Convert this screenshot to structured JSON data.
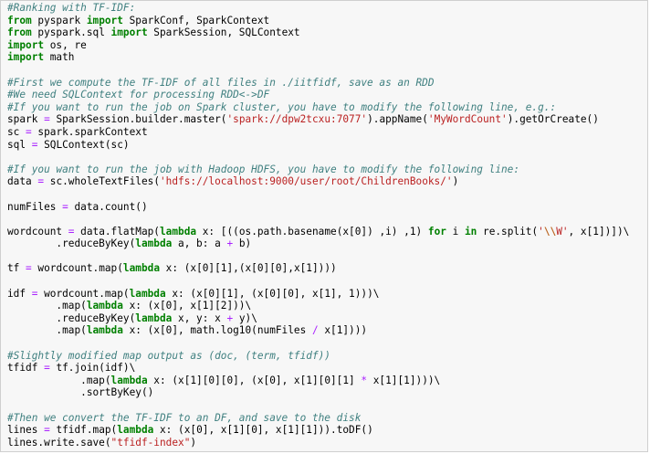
{
  "cell": {
    "lines": [
      [
        {
          "t": "c",
          "v": "#Ranking with TF-IDF:"
        }
      ],
      [
        {
          "t": "k",
          "v": "from"
        },
        {
          "t": "p",
          "v": " pyspark "
        },
        {
          "t": "k",
          "v": "import"
        },
        {
          "t": "p",
          "v": " SparkConf, SparkContext"
        }
      ],
      [
        {
          "t": "k",
          "v": "from"
        },
        {
          "t": "p",
          "v": " pyspark.sql "
        },
        {
          "t": "k",
          "v": "import"
        },
        {
          "t": "p",
          "v": " SparkSession, SQLContext"
        }
      ],
      [
        {
          "t": "k",
          "v": "import"
        },
        {
          "t": "p",
          "v": " os, re"
        }
      ],
      [
        {
          "t": "k",
          "v": "import"
        },
        {
          "t": "p",
          "v": " math"
        }
      ],
      [],
      [
        {
          "t": "c",
          "v": "#First we compute the TF-IDF of all files in ./iitfidf, save as an RDD"
        }
      ],
      [
        {
          "t": "c",
          "v": "#We need SQLContext for processing RDD<->DF"
        }
      ],
      [
        {
          "t": "c",
          "v": "#If you want to run the job on Spark cluster, you have to modify the following line, e.g.:"
        }
      ],
      [
        {
          "t": "p",
          "v": "spark "
        },
        {
          "t": "o",
          "v": "="
        },
        {
          "t": "p",
          "v": " SparkSession.builder.master("
        },
        {
          "t": "s",
          "v": "'spark://dpw2tcxu:7077'"
        },
        {
          "t": "p",
          "v": ").appName("
        },
        {
          "t": "s",
          "v": "'MyWordCount'"
        },
        {
          "t": "p",
          "v": ").getOrCreate()"
        }
      ],
      [
        {
          "t": "p",
          "v": "sc "
        },
        {
          "t": "o",
          "v": "="
        },
        {
          "t": "p",
          "v": " spark.sparkContext"
        }
      ],
      [
        {
          "t": "p",
          "v": "sql "
        },
        {
          "t": "o",
          "v": "="
        },
        {
          "t": "p",
          "v": " SQLContext(sc)"
        }
      ],
      [],
      [
        {
          "t": "c",
          "v": "#If you want to run the job with Hadoop HDFS, you have to modify the following line:"
        }
      ],
      [
        {
          "t": "p",
          "v": "data "
        },
        {
          "t": "o",
          "v": "="
        },
        {
          "t": "p",
          "v": " sc.wholeTextFiles("
        },
        {
          "t": "s",
          "v": "'hdfs://localhost:9000/user/root/ChildrenBooks/'"
        },
        {
          "t": "p",
          "v": ")"
        }
      ],
      [],
      [
        {
          "t": "p",
          "v": "numFiles "
        },
        {
          "t": "o",
          "v": "="
        },
        {
          "t": "p",
          "v": " data.count()"
        }
      ],
      [],
      [
        {
          "t": "p",
          "v": "wordcount "
        },
        {
          "t": "o",
          "v": "="
        },
        {
          "t": "p",
          "v": " data.flatMap("
        },
        {
          "t": "k",
          "v": "lambda"
        },
        {
          "t": "p",
          "v": " x: [((os.path.basename(x[0]) ,i) ,1) "
        },
        {
          "t": "k",
          "v": "for"
        },
        {
          "t": "p",
          "v": " i "
        },
        {
          "t": "k",
          "v": "in"
        },
        {
          "t": "p",
          "v": " re.split("
        },
        {
          "t": "s",
          "v": "'"
        },
        {
          "t": "se",
          "v": "\\\\"
        },
        {
          "t": "s",
          "v": "W'"
        },
        {
          "t": "p",
          "v": ", x[1])])\\"
        }
      ],
      [
        {
          "t": "p",
          "v": "        .reduceByKey("
        },
        {
          "t": "k",
          "v": "lambda"
        },
        {
          "t": "p",
          "v": " a, b: a "
        },
        {
          "t": "o",
          "v": "+"
        },
        {
          "t": "p",
          "v": " b)"
        }
      ],
      [],
      [
        {
          "t": "p",
          "v": "tf "
        },
        {
          "t": "o",
          "v": "="
        },
        {
          "t": "p",
          "v": " wordcount.map("
        },
        {
          "t": "k",
          "v": "lambda"
        },
        {
          "t": "p",
          "v": " x: (x[0][1],(x[0][0],x[1])))"
        }
      ],
      [],
      [
        {
          "t": "p",
          "v": "idf "
        },
        {
          "t": "o",
          "v": "="
        },
        {
          "t": "p",
          "v": " wordcount.map("
        },
        {
          "t": "k",
          "v": "lambda"
        },
        {
          "t": "p",
          "v": " x: (x[0][1], (x[0][0], x[1], 1)))\\"
        }
      ],
      [
        {
          "t": "p",
          "v": "        .map("
        },
        {
          "t": "k",
          "v": "lambda"
        },
        {
          "t": "p",
          "v": " x: (x[0], x[1][2]))\\"
        }
      ],
      [
        {
          "t": "p",
          "v": "        .reduceByKey("
        },
        {
          "t": "k",
          "v": "lambda"
        },
        {
          "t": "p",
          "v": " x, y: x "
        },
        {
          "t": "o",
          "v": "+"
        },
        {
          "t": "p",
          "v": " y)\\"
        }
      ],
      [
        {
          "t": "p",
          "v": "        .map("
        },
        {
          "t": "k",
          "v": "lambda"
        },
        {
          "t": "p",
          "v": " x: (x[0], math.log10(numFiles "
        },
        {
          "t": "o",
          "v": "/"
        },
        {
          "t": "p",
          "v": " x[1])))"
        }
      ],
      [],
      [
        {
          "t": "c",
          "v": "#Slightly modified map output as (doc, (term, tfidf))"
        }
      ],
      [
        {
          "t": "p",
          "v": "tfidf "
        },
        {
          "t": "o",
          "v": "="
        },
        {
          "t": "p",
          "v": " tf.join(idf)\\"
        }
      ],
      [
        {
          "t": "p",
          "v": "            .map("
        },
        {
          "t": "k",
          "v": "lambda"
        },
        {
          "t": "p",
          "v": " x: (x[1][0][0], (x[0], x[1][0][1] "
        },
        {
          "t": "o",
          "v": "*"
        },
        {
          "t": "p",
          "v": " x[1][1])))\\"
        }
      ],
      [
        {
          "t": "p",
          "v": "            .sortByKey()"
        }
      ],
      [],
      [
        {
          "t": "c",
          "v": "#Then we convert the TF-IDF to an DF, and save to the disk"
        }
      ],
      [
        {
          "t": "p",
          "v": "lines "
        },
        {
          "t": "o",
          "v": "="
        },
        {
          "t": "p",
          "v": " tfidf.map("
        },
        {
          "t": "k",
          "v": "lambda"
        },
        {
          "t": "p",
          "v": " x: (x[0], x[1][0], x[1][1])).toDF()"
        }
      ],
      [
        {
          "t": "p",
          "v": "lines.write.save("
        },
        {
          "t": "s",
          "v": "\"tfidf-index\""
        },
        {
          "t": "p",
          "v": ")"
        }
      ]
    ]
  }
}
